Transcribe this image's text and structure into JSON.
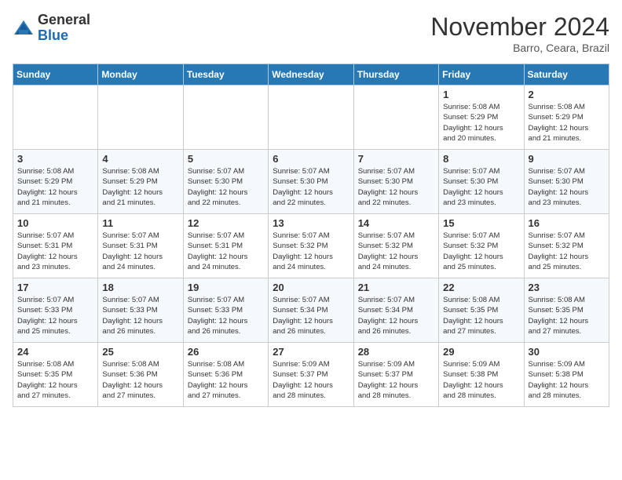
{
  "logo": {
    "general": "General",
    "blue": "Blue"
  },
  "title": "November 2024",
  "location": "Barro, Ceara, Brazil",
  "weekdays": [
    "Sunday",
    "Monday",
    "Tuesday",
    "Wednesday",
    "Thursday",
    "Friday",
    "Saturday"
  ],
  "weeks": [
    [
      {
        "day": "",
        "info": ""
      },
      {
        "day": "",
        "info": ""
      },
      {
        "day": "",
        "info": ""
      },
      {
        "day": "",
        "info": ""
      },
      {
        "day": "",
        "info": ""
      },
      {
        "day": "1",
        "info": "Sunrise: 5:08 AM\nSunset: 5:29 PM\nDaylight: 12 hours\nand 20 minutes."
      },
      {
        "day": "2",
        "info": "Sunrise: 5:08 AM\nSunset: 5:29 PM\nDaylight: 12 hours\nand 21 minutes."
      }
    ],
    [
      {
        "day": "3",
        "info": "Sunrise: 5:08 AM\nSunset: 5:29 PM\nDaylight: 12 hours\nand 21 minutes."
      },
      {
        "day": "4",
        "info": "Sunrise: 5:08 AM\nSunset: 5:29 PM\nDaylight: 12 hours\nand 21 minutes."
      },
      {
        "day": "5",
        "info": "Sunrise: 5:07 AM\nSunset: 5:30 PM\nDaylight: 12 hours\nand 22 minutes."
      },
      {
        "day": "6",
        "info": "Sunrise: 5:07 AM\nSunset: 5:30 PM\nDaylight: 12 hours\nand 22 minutes."
      },
      {
        "day": "7",
        "info": "Sunrise: 5:07 AM\nSunset: 5:30 PM\nDaylight: 12 hours\nand 22 minutes."
      },
      {
        "day": "8",
        "info": "Sunrise: 5:07 AM\nSunset: 5:30 PM\nDaylight: 12 hours\nand 23 minutes."
      },
      {
        "day": "9",
        "info": "Sunrise: 5:07 AM\nSunset: 5:30 PM\nDaylight: 12 hours\nand 23 minutes."
      }
    ],
    [
      {
        "day": "10",
        "info": "Sunrise: 5:07 AM\nSunset: 5:31 PM\nDaylight: 12 hours\nand 23 minutes."
      },
      {
        "day": "11",
        "info": "Sunrise: 5:07 AM\nSunset: 5:31 PM\nDaylight: 12 hours\nand 24 minutes."
      },
      {
        "day": "12",
        "info": "Sunrise: 5:07 AM\nSunset: 5:31 PM\nDaylight: 12 hours\nand 24 minutes."
      },
      {
        "day": "13",
        "info": "Sunrise: 5:07 AM\nSunset: 5:32 PM\nDaylight: 12 hours\nand 24 minutes."
      },
      {
        "day": "14",
        "info": "Sunrise: 5:07 AM\nSunset: 5:32 PM\nDaylight: 12 hours\nand 24 minutes."
      },
      {
        "day": "15",
        "info": "Sunrise: 5:07 AM\nSunset: 5:32 PM\nDaylight: 12 hours\nand 25 minutes."
      },
      {
        "day": "16",
        "info": "Sunrise: 5:07 AM\nSunset: 5:32 PM\nDaylight: 12 hours\nand 25 minutes."
      }
    ],
    [
      {
        "day": "17",
        "info": "Sunrise: 5:07 AM\nSunset: 5:33 PM\nDaylight: 12 hours\nand 25 minutes."
      },
      {
        "day": "18",
        "info": "Sunrise: 5:07 AM\nSunset: 5:33 PM\nDaylight: 12 hours\nand 26 minutes."
      },
      {
        "day": "19",
        "info": "Sunrise: 5:07 AM\nSunset: 5:33 PM\nDaylight: 12 hours\nand 26 minutes."
      },
      {
        "day": "20",
        "info": "Sunrise: 5:07 AM\nSunset: 5:34 PM\nDaylight: 12 hours\nand 26 minutes."
      },
      {
        "day": "21",
        "info": "Sunrise: 5:07 AM\nSunset: 5:34 PM\nDaylight: 12 hours\nand 26 minutes."
      },
      {
        "day": "22",
        "info": "Sunrise: 5:08 AM\nSunset: 5:35 PM\nDaylight: 12 hours\nand 27 minutes."
      },
      {
        "day": "23",
        "info": "Sunrise: 5:08 AM\nSunset: 5:35 PM\nDaylight: 12 hours\nand 27 minutes."
      }
    ],
    [
      {
        "day": "24",
        "info": "Sunrise: 5:08 AM\nSunset: 5:35 PM\nDaylight: 12 hours\nand 27 minutes."
      },
      {
        "day": "25",
        "info": "Sunrise: 5:08 AM\nSunset: 5:36 PM\nDaylight: 12 hours\nand 27 minutes."
      },
      {
        "day": "26",
        "info": "Sunrise: 5:08 AM\nSunset: 5:36 PM\nDaylight: 12 hours\nand 27 minutes."
      },
      {
        "day": "27",
        "info": "Sunrise: 5:09 AM\nSunset: 5:37 PM\nDaylight: 12 hours\nand 28 minutes."
      },
      {
        "day": "28",
        "info": "Sunrise: 5:09 AM\nSunset: 5:37 PM\nDaylight: 12 hours\nand 28 minutes."
      },
      {
        "day": "29",
        "info": "Sunrise: 5:09 AM\nSunset: 5:38 PM\nDaylight: 12 hours\nand 28 minutes."
      },
      {
        "day": "30",
        "info": "Sunrise: 5:09 AM\nSunset: 5:38 PM\nDaylight: 12 hours\nand 28 minutes."
      }
    ]
  ]
}
